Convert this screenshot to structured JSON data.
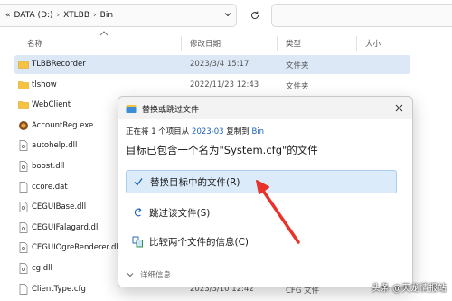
{
  "address_bar": {
    "overflow_chevron": "«",
    "segments": [
      "DATA (D:)",
      "XTLBB",
      "Bin"
    ],
    "separator": "›"
  },
  "columns": {
    "name": "名称",
    "modified": "修改日期",
    "type": "类型",
    "size": "大小"
  },
  "files": [
    {
      "name": "TLBBRecorder",
      "date": "2023/3/4 15:17",
      "type": "文件夹",
      "icon": "folder-icon",
      "selected": true
    },
    {
      "name": "tlshow",
      "date": "2022/11/23 12:43",
      "type": "文件夹",
      "icon": "folder-icon"
    },
    {
      "name": "WebClient",
      "date": "",
      "type": "",
      "icon": "folder-icon"
    },
    {
      "name": "AccountReg.exe",
      "date": "",
      "type": "",
      "icon": "exe-icon"
    },
    {
      "name": "autohelp.dll",
      "date": "",
      "type": "",
      "icon": "dll-file-icon"
    },
    {
      "name": "boost.dll",
      "date": "",
      "type": "",
      "icon": "dll-file-icon"
    },
    {
      "name": "ccore.dat",
      "date": "",
      "type": "",
      "icon": "file-icon"
    },
    {
      "name": "CEGUIBase.dll",
      "date": "",
      "type": "",
      "icon": "dll-file-icon"
    },
    {
      "name": "CEGUIFalagard.dll",
      "date": "",
      "type": "",
      "icon": "dll-file-icon"
    },
    {
      "name": "CEGUIOgreRenderer.dll",
      "date": "",
      "type": "",
      "icon": "dll-file-icon"
    },
    {
      "name": "cg.dll",
      "date": "",
      "type": "",
      "icon": "dll-file-icon"
    },
    {
      "name": "ClientType.cfg",
      "date": "2023/3/10 12:42",
      "type": "CFG 文件",
      "icon": "file-icon"
    }
  ],
  "dialog": {
    "title": "替换或跳过文件",
    "progress_prefix": "正在将 1 个项目从",
    "source": "2023-03",
    "progress_mid": "复制到",
    "destination": "Bin",
    "message": "目标已包含一个名为\"System.cfg\"的文件",
    "options": [
      {
        "label": "替换目标中的文件(R)",
        "icon": "checkmark-icon",
        "highlighted": true
      },
      {
        "label": "跳过该文件(S)",
        "icon": "skip-arrow-icon",
        "highlighted": false
      },
      {
        "label": "比较两个文件的信息(C)",
        "icon": "compare-icon",
        "highlighted": false
      }
    ],
    "details_label": "详细信息"
  },
  "watermark": "头条 @天龙情报站",
  "colors": {
    "accent": "#1a5fb4",
    "selection": "#dce8f5",
    "option_highlight": "#dcebfa",
    "annotation_arrow": "#e8322a",
    "folder": "#f5c242"
  }
}
